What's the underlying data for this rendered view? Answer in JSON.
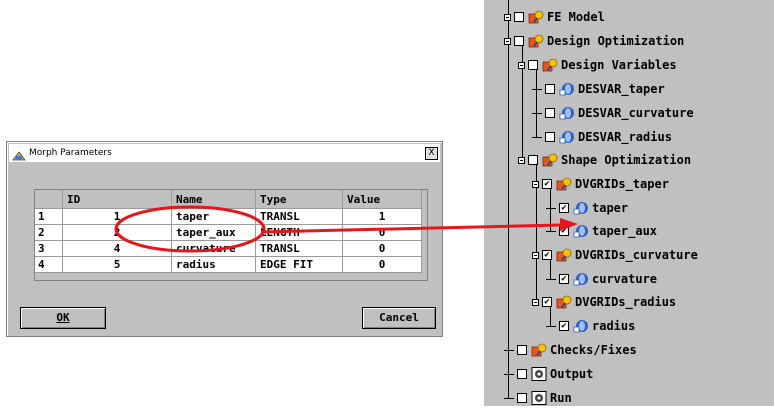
{
  "dialog": {
    "title": "Morph Parameters",
    "close_label": "X",
    "columns": [
      "ID",
      "Name",
      "Type",
      "Value"
    ],
    "rows": [
      {
        "num": "1",
        "id": "1",
        "name": "taper",
        "type": "TRANSL",
        "value": "1"
      },
      {
        "num": "2",
        "id": "2",
        "name": "taper_aux",
        "type": "LENGTH",
        "value": "0"
      },
      {
        "num": "3",
        "id": "4",
        "name": "curvature",
        "type": "TRANSL",
        "value": "0"
      },
      {
        "num": "4",
        "id": "5",
        "name": "radius",
        "type": "EDGE FIT",
        "value": "0"
      }
    ],
    "ok_label": "OK",
    "cancel_label": "Cancel"
  },
  "tree": {
    "items": [
      {
        "label": "FE Model",
        "checked": false,
        "icon": "model-icon"
      },
      {
        "label": "Design Optimization",
        "checked": false,
        "icon": "model-icon"
      },
      {
        "label": "Design Variables",
        "checked": false,
        "icon": "model-icon"
      },
      {
        "label": "DESVAR_taper",
        "checked": false,
        "icon": "variable-icon"
      },
      {
        "label": "DESVAR_curvature",
        "checked": false,
        "icon": "variable-icon"
      },
      {
        "label": "DESVAR_radius",
        "checked": false,
        "icon": "variable-icon"
      },
      {
        "label": "Shape Optimization",
        "checked": false,
        "icon": "model-icon"
      },
      {
        "label": "DVGRIDs_taper",
        "checked": true,
        "icon": "model-icon"
      },
      {
        "label": "taper",
        "checked": true,
        "icon": "variable-icon"
      },
      {
        "label": "taper_aux",
        "checked": true,
        "icon": "variable-icon"
      },
      {
        "label": "DVGRIDs_curvature",
        "checked": true,
        "icon": "model-icon"
      },
      {
        "label": "curvature",
        "checked": true,
        "icon": "variable-icon"
      },
      {
        "label": "DVGRIDs_radius",
        "checked": true,
        "icon": "model-icon"
      },
      {
        "label": "radius",
        "checked": true,
        "icon": "variable-icon"
      },
      {
        "label": "Checks/Fixes",
        "checked": false,
        "icon": "model-icon"
      },
      {
        "label": "Output",
        "checked": false,
        "icon": "gear-icon"
      },
      {
        "label": "Run",
        "checked": false,
        "icon": "gear-icon"
      }
    ]
  },
  "colors": {
    "highlight_red": "#e8161b",
    "panel_gray": "#c0c0c0",
    "model_orange": "#e8561a"
  }
}
